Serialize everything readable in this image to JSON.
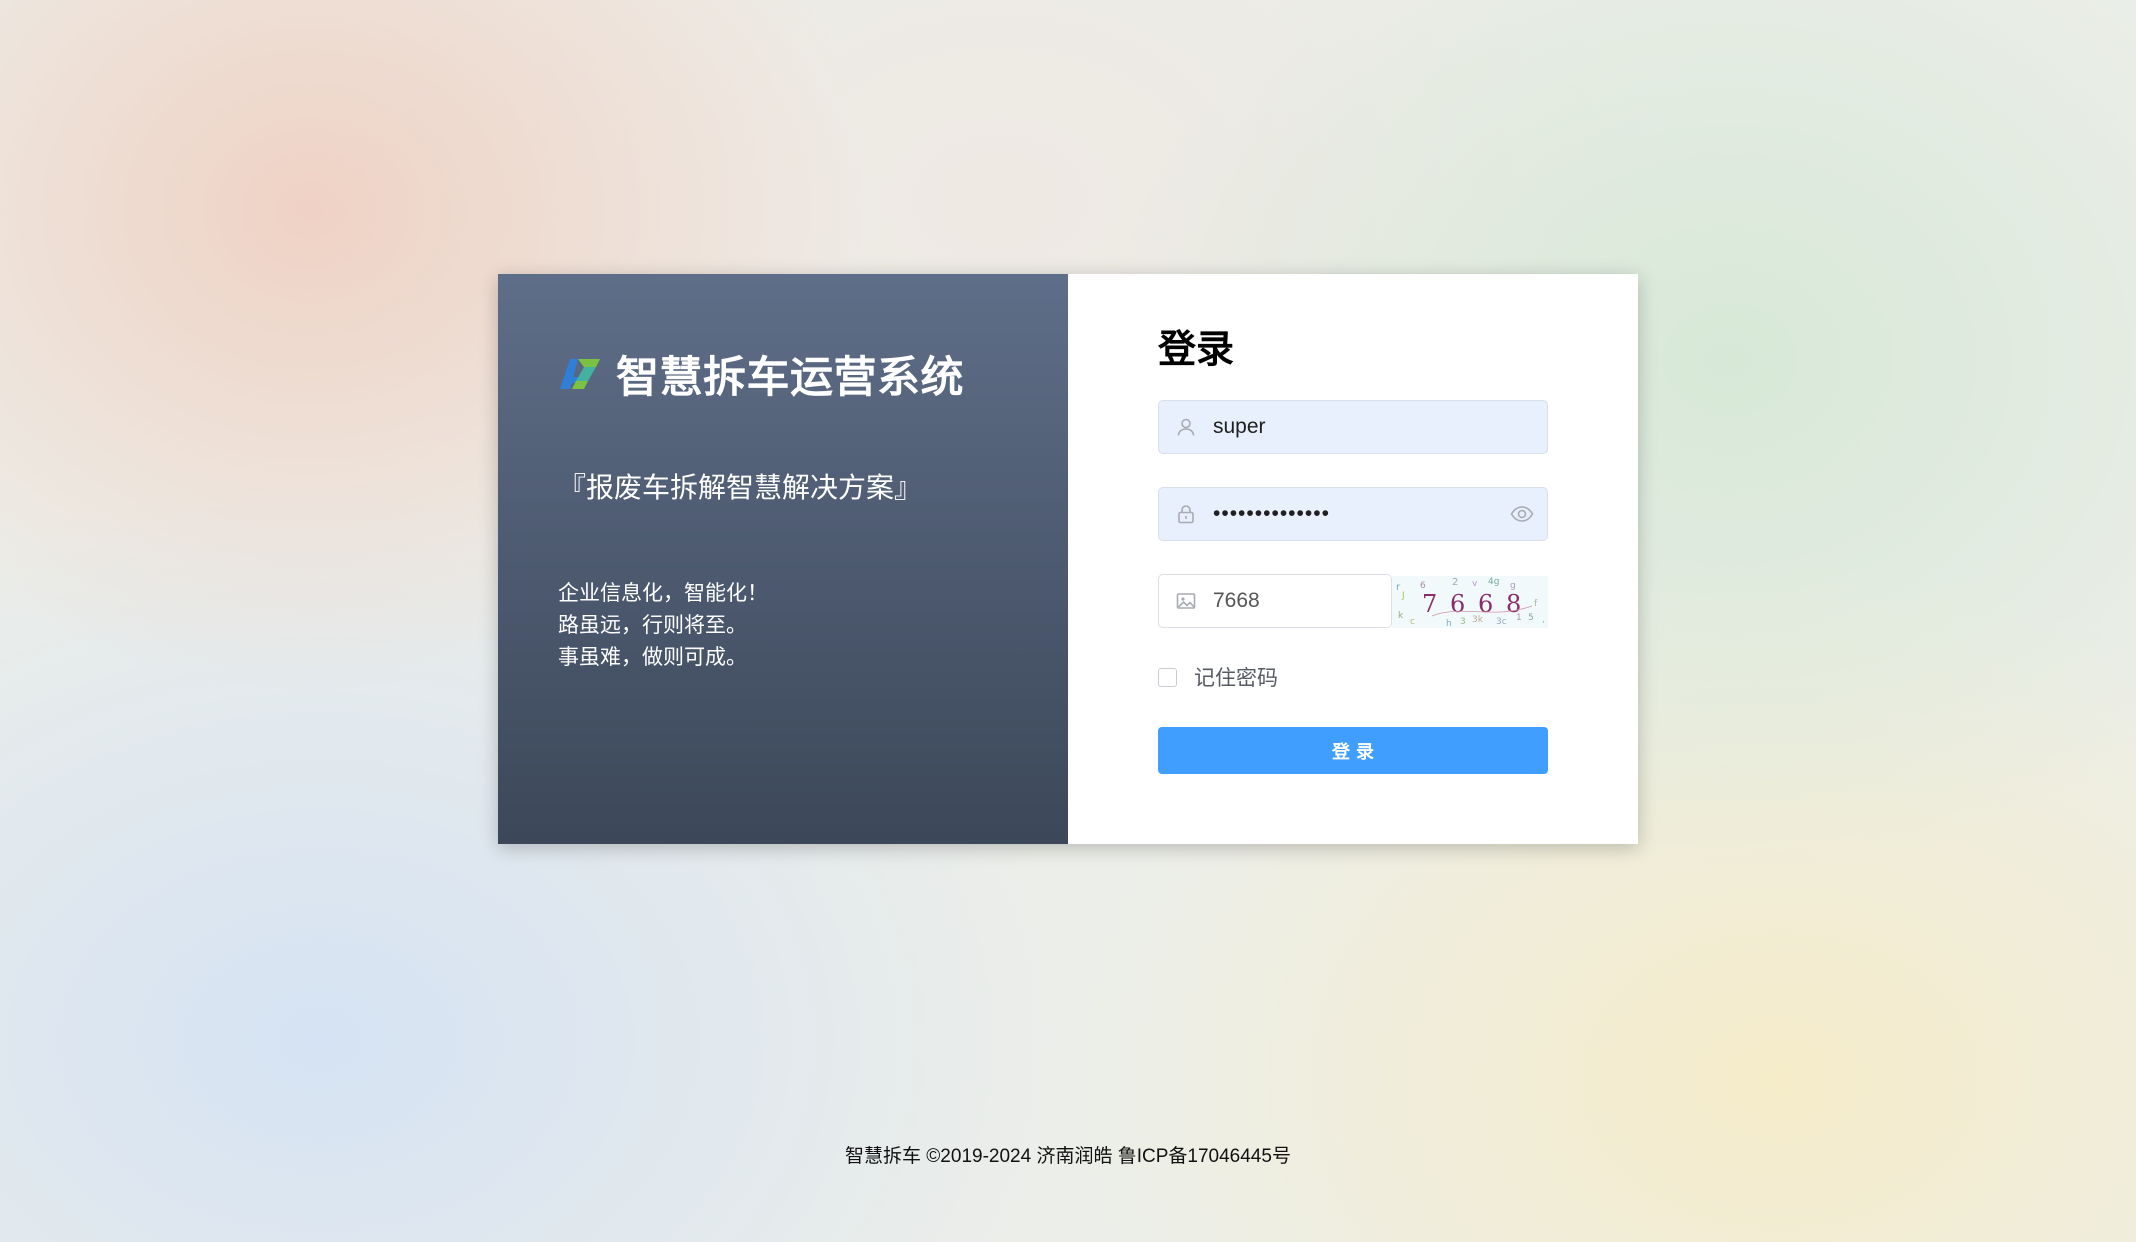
{
  "brand": {
    "logo": "as-logo-icon",
    "title": "智慧拆车运营系统",
    "slogan": "『报废车拆解智慧解决方案』",
    "motto": [
      "企业信息化，智能化！",
      "路虽远，行则将至。",
      "事虽难，做则可成。"
    ],
    "panel_gradient": [
      "#5f6e88",
      "#3c4859"
    ]
  },
  "login": {
    "title": "登录",
    "username": {
      "icon": "user-icon",
      "value": "super",
      "placeholder": ""
    },
    "password": {
      "icon": "lock-icon",
      "value": "••••••••••••••",
      "toggle_icon": "eye-icon"
    },
    "captcha": {
      "icon": "image-icon",
      "value": "7668",
      "image_text": "7668"
    },
    "remember": {
      "label": "记住密码",
      "checked": false
    },
    "submit_label": "登录",
    "accent": "#409eff"
  },
  "footer": {
    "text": "智慧拆车 ©2019-2024 济南润皓 鲁ICP备17046445号"
  }
}
